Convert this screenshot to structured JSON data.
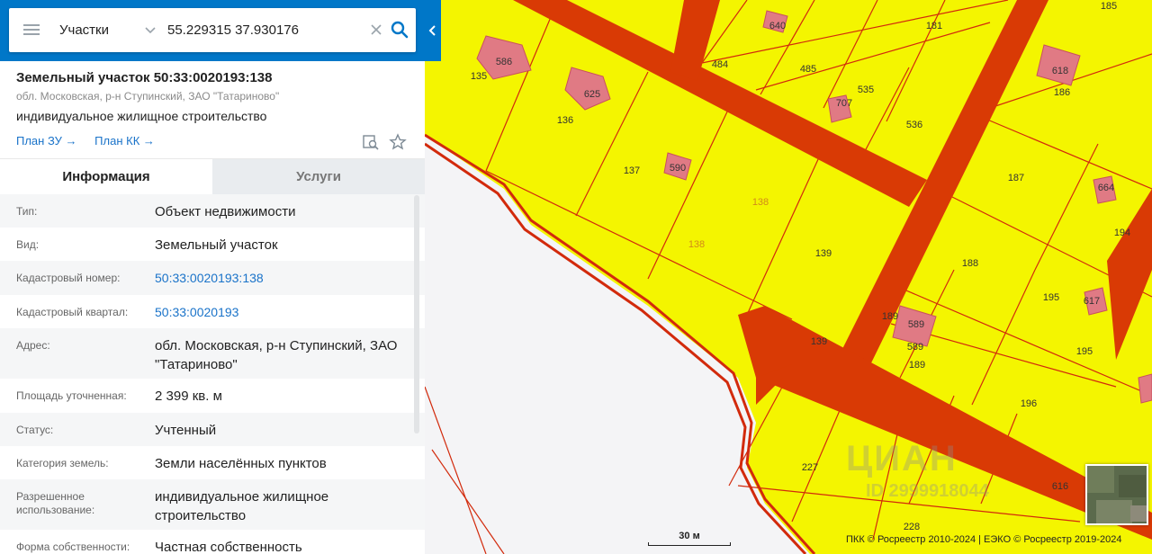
{
  "search": {
    "type_label": "Участки",
    "query": "55.229315 37.930176"
  },
  "object": {
    "title": "Земельный участок 50:33:0020193:138",
    "address": "обл. Московская, р-н Ступинский, ЗАО \"Татариново\"",
    "use": "индивидуальное жилищное строительство",
    "plan_zu": "План ЗУ",
    "plan_kk": "План КК"
  },
  "tabs": [
    {
      "label": "Информация",
      "active": true
    },
    {
      "label": "Услуги",
      "active": false
    }
  ],
  "info_rows": [
    {
      "label": "Тип:",
      "value": "Объект недвижимости"
    },
    {
      "label": "Вид:",
      "value": "Земельный участок"
    },
    {
      "label": "Кадастровый номер:",
      "value": "50:33:0020193:138"
    },
    {
      "label": "Кадастровый квартал:",
      "value": "50:33:0020193"
    },
    {
      "label": "Адрес:",
      "value": "обл. Московская, р-н Ступинский, ЗАО \"Татариново\""
    },
    {
      "label": "Площадь уточненная:",
      "value": "2 399 кв. м"
    },
    {
      "label": "Статус:",
      "value": "Учтенный"
    },
    {
      "label": "Категория земель:",
      "value": "Земли населённых пунктов"
    },
    {
      "label": "Разрешенное использование:",
      "value": "индивидуальное жилищное строительство"
    },
    {
      "label": "Форма собственности:",
      "value": "Частная собственность"
    }
  ],
  "map": {
    "scale_label": "30 м",
    "copyright": "ПКК © Росреестр 2010-2024 | ЕЭКО © Росреестр 2019-2024",
    "watermark": "ЦИАН",
    "watermark_id": "ID 2999918044",
    "parcel_labels": [
      "185",
      "586",
      "135",
      "484",
      "640",
      "181",
      "625",
      "485",
      "618",
      "186",
      "136",
      "707",
      "535",
      "536",
      "137",
      "590",
      "138",
      "187",
      "664",
      "194",
      "139",
      "188",
      "195",
      "617",
      "589",
      "189",
      "227",
      "196",
      "616",
      "228"
    ],
    "colors": {
      "parcel_fill": "#f4f500",
      "road_fill": "#d93a05",
      "boundary": "#d22a0c",
      "building": "#e07a84",
      "selected_fill": "#f7f53a",
      "empty": "#f4f4f6"
    }
  }
}
